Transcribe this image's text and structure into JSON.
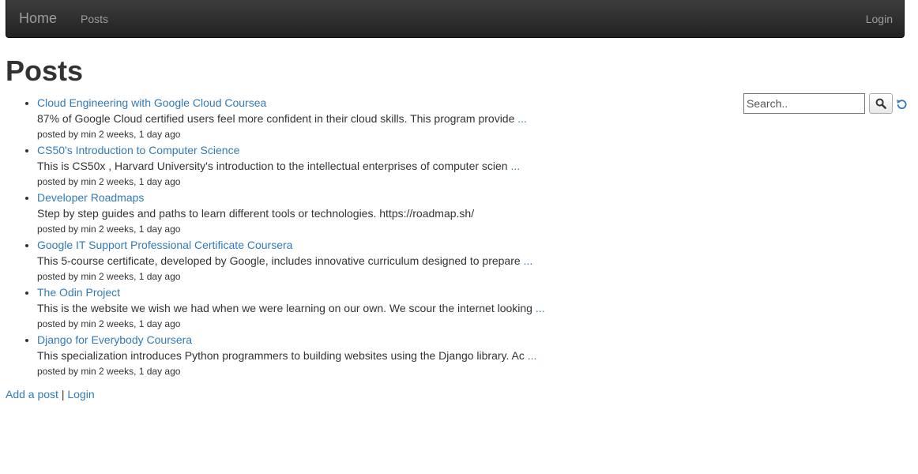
{
  "navbar": {
    "brand": "Home",
    "posts_link": "Posts",
    "login_link": "Login"
  },
  "page_title": "Posts",
  "posts": [
    {
      "title": "Cloud Engineering with Google Cloud Coursea",
      "excerpt": "87% of Google Cloud certified users feel more confident in their cloud skills. This program provide",
      "more": "...",
      "meta": "posted by min 2 weeks, 1 day ago"
    },
    {
      "title": "CS50's Introduction to Computer Science",
      "excerpt": "This is CS50x , Harvard University's introduction to the intellectual enterprises of computer scien",
      "more": "...",
      "meta": "posted by min 2 weeks, 1 day ago"
    },
    {
      "title": "Developer Roadmaps",
      "excerpt": "Step by step guides and paths to learn different tools or technologies. https://roadmap.sh/",
      "more": "",
      "meta": "posted by min 2 weeks, 1 day ago"
    },
    {
      "title": "Google IT Support Professional Certificate Coursera",
      "excerpt": "This 5-course certificate, developed by Google, includes innovative curriculum designed to prepare",
      "more": "...",
      "meta": "posted by min 2 weeks, 1 day ago"
    },
    {
      "title": "The Odin Project",
      "excerpt": "This is the website we wish we had when we were learning on our own. We scour the internet looking",
      "more": "...",
      "meta": "posted by min 2 weeks, 1 day ago"
    },
    {
      "title": "Django for Everybody Coursera",
      "excerpt": "This specialization introduces Python programmers to building websites using the Django library. Ac",
      "more": "...",
      "meta": "posted by min 2 weeks, 1 day ago"
    }
  ],
  "footer": {
    "add_post": "Add a post",
    "separator": "|",
    "login": "Login"
  },
  "search": {
    "placeholder": "Search..",
    "value": ""
  },
  "icons": {
    "search": "search-icon",
    "reset": "refresh-icon"
  },
  "colors": {
    "link": "#337ab7",
    "navbar": "#222222",
    "nav_text": "#9d9d9d"
  }
}
